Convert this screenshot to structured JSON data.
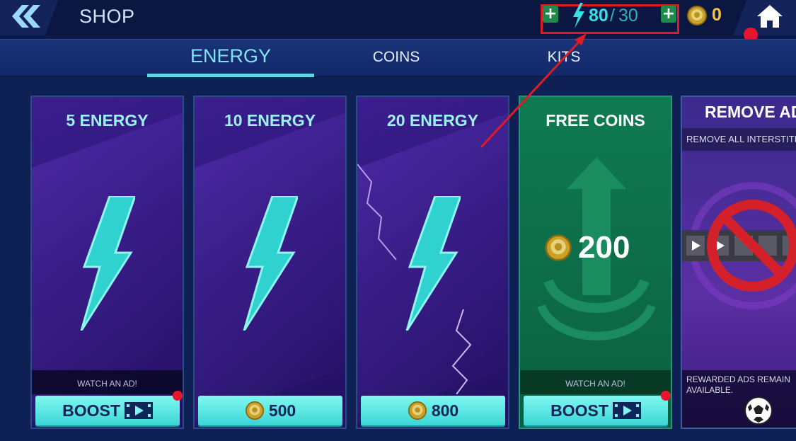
{
  "header": {
    "title": "SHOP",
    "energy_current": "80",
    "energy_separator": "/",
    "energy_max": "30",
    "coins": "0"
  },
  "tabs": [
    {
      "label": "ENERGY",
      "active": true
    },
    {
      "label": "COINS",
      "active": false
    },
    {
      "label": "KITS",
      "active": false
    }
  ],
  "cards": [
    {
      "title": "5 ENERGY",
      "strip": "WATCH AN AD!",
      "button": "BOOST",
      "button_icon": "video-play-icon"
    },
    {
      "title": "10 ENERGY",
      "price": "500",
      "button_icon": "coin-icon"
    },
    {
      "title": "20 ENERGY",
      "price": "800",
      "button_icon": "coin-icon"
    },
    {
      "title": "FREE COINS",
      "amount": "200",
      "strip": "WATCH AN AD!",
      "button": "BOOST",
      "button_icon": "video-play-icon"
    },
    {
      "title": "REMOVE AD",
      "subtitle": "REMOVE ALL INTERSTITIA",
      "note": "REWARDED ADS REMAIN AVAILABLE."
    }
  ],
  "colors": {
    "accent_cyan": "#35e1e3",
    "coin_gold": "#f5c542",
    "highlight_red": "#e01b24",
    "card_purple": "#2d1577",
    "card_green": "#0d6b48"
  },
  "icons": [
    "back-chevrons-icon",
    "plus-icon",
    "lightning-bolt-icon",
    "coin-icon",
    "home-icon",
    "video-play-icon",
    "no-ads-icon",
    "soccer-ball-icon"
  ]
}
